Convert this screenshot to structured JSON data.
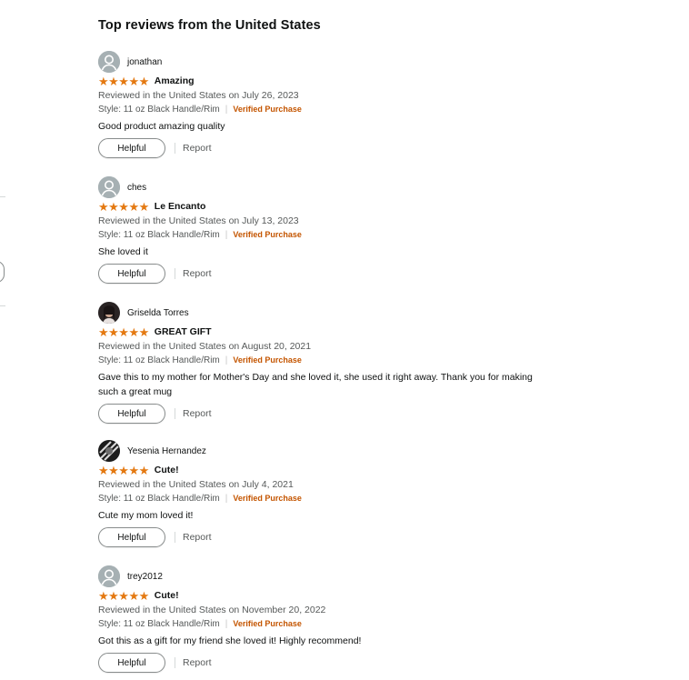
{
  "section_title": "Top reviews from the United States",
  "colors": {
    "star": "#e47911",
    "verified": "#c45500",
    "muted": "#565959"
  },
  "reviews": [
    {
      "name": "jonathan",
      "avatar": "default-avatar-icon",
      "rating": 5,
      "stars": "★★★★★",
      "title": "Amazing",
      "date": "Reviewed in the United States on July 26, 2023",
      "style": "Style: 11 oz Black Handle/Rim",
      "verified": "Verified Purchase",
      "text": "Good product amazing quality",
      "helpful": "Helpful",
      "report": "Report"
    },
    {
      "name": "ches",
      "avatar": "default-avatar-icon",
      "rating": 5,
      "stars": "★★★★★",
      "title": "Le Encanto",
      "date": "Reviewed in the United States on July 13, 2023",
      "style": "Style: 11 oz Black Handle/Rim",
      "verified": "Verified Purchase",
      "text": "She loved it",
      "helpful": "Helpful",
      "report": "Report"
    },
    {
      "name": "Griselda Torres",
      "avatar": "photo-avatar",
      "rating": 5,
      "stars": "★★★★★",
      "title": "GREAT GIFT",
      "date": "Reviewed in the United States on August 20, 2021",
      "style": "Style: 11 oz Black Handle/Rim",
      "verified": "Verified Purchase",
      "text": "Gave this to my mother for Mother's Day and she loved it, she used it right away. Thank you for making such a great mug",
      "helpful": "Helpful",
      "report": "Report"
    },
    {
      "name": "Yesenia Hernandez",
      "avatar": "photo-avatar",
      "rating": 5,
      "stars": "★★★★★",
      "title": "Cute!",
      "date": "Reviewed in the United States on July 4, 2021",
      "style": "Style: 11 oz Black Handle/Rim",
      "verified": "Verified Purchase",
      "text": "Cute my mom loved it!",
      "helpful": "Helpful",
      "report": "Report"
    },
    {
      "name": "trey2012",
      "avatar": "default-avatar-icon",
      "rating": 5,
      "stars": "★★★★★",
      "title": "Cute!",
      "date": "Reviewed in the United States on November 20, 2022",
      "style": "Style: 11 oz Black Handle/Rim",
      "verified": "Verified Purchase",
      "text": "Got this as a gift for my friend she loved it! Highly recommend!",
      "helpful": "Helpful",
      "report": "Report"
    }
  ]
}
